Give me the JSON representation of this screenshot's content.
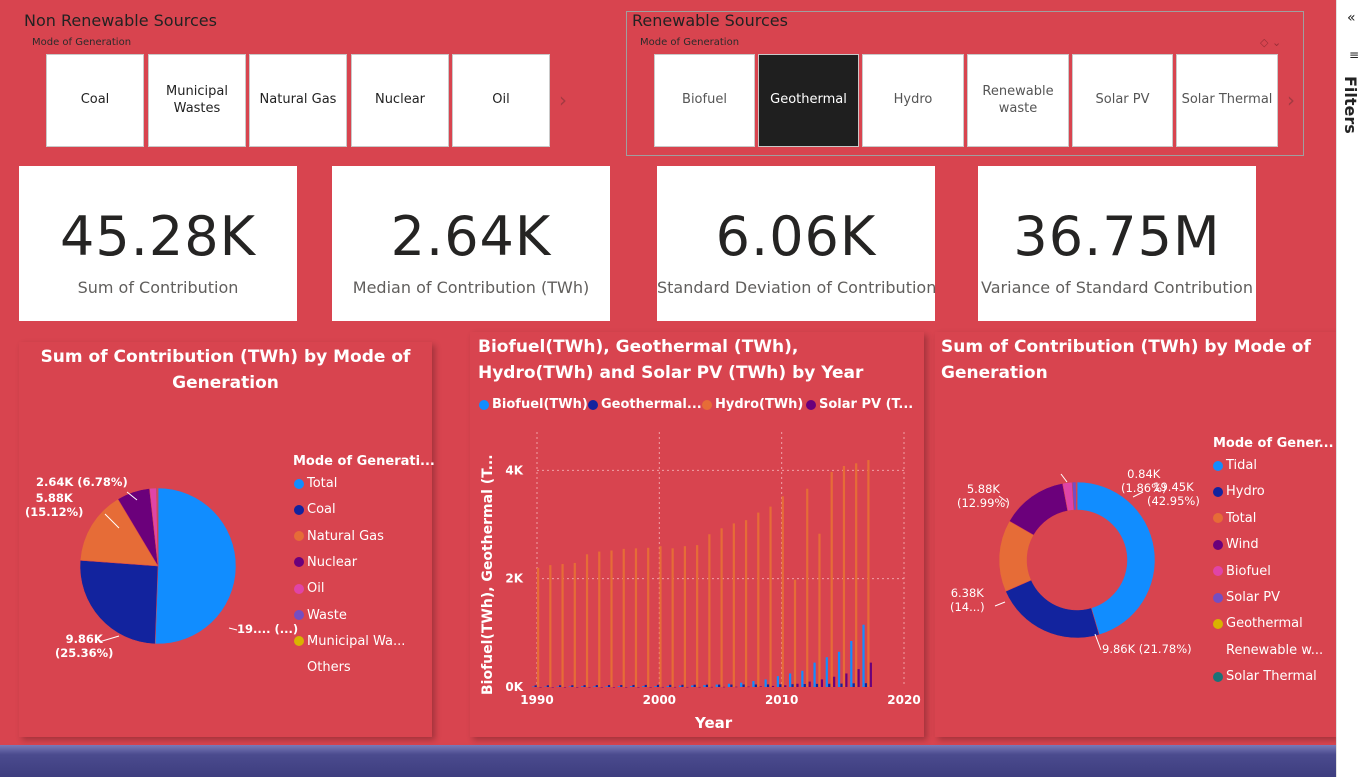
{
  "non_renewable": {
    "title": "Non Renewable Sources",
    "subtitle": "Mode of Generation",
    "options": [
      "Coal",
      "Municipal Wastes",
      "Natural Gas",
      "Nuclear",
      "Oil"
    ]
  },
  "renewable": {
    "title": "Renewable Sources",
    "subtitle": "Mode of Generation",
    "options": [
      "Biofuel",
      "Geothermal",
      "Hydro",
      "Renewable waste",
      "Solar PV",
      "Solar Thermal"
    ],
    "selected": "Geothermal"
  },
  "cards": [
    {
      "value": "45.28K",
      "label": "Sum of Contribution"
    },
    {
      "value": "2.64K",
      "label": "Median of Contribution (TWh)"
    },
    {
      "value": "6.06K",
      "label": "Standard Deviation of Contribution"
    },
    {
      "value": "36.75M",
      "label": "Variance of Standard Contribution"
    }
  ],
  "pie_panel": {
    "title": "Sum of Contribution (TWh) by Mode of Generation",
    "legend_title": "Mode of Generati...",
    "legend": [
      {
        "name": "Total",
        "color": "#118dff"
      },
      {
        "name": "Coal",
        "color": "#12239e"
      },
      {
        "name": "Natural Gas",
        "color": "#e66c37"
      },
      {
        "name": "Nuclear",
        "color": "#6b007b"
      },
      {
        "name": "Oil",
        "color": "#e044a7"
      },
      {
        "name": "Waste",
        "color": "#744ec2"
      },
      {
        "name": "Municipal Wa...",
        "color": "#d9b300"
      },
      {
        "name": "Others",
        "color": ""
      }
    ],
    "labels": {
      "total": "19.... (...)",
      "coal": "9.86K\n(25.36%)",
      "gas": "5.88K\n(15.12%)",
      "nuclear": "2.64K (6.78%)"
    }
  },
  "bar_panel": {
    "title": "Biofuel(TWh), Geothermal (TWh), Hydro(TWh) and Solar PV (TWh) by Year",
    "legend": [
      {
        "name": "Biofuel(TWh)",
        "color": "#118dff"
      },
      {
        "name": "Geothermal...",
        "color": "#12239e"
      },
      {
        "name": "Hydro(TWh)",
        "color": "#e66c37"
      },
      {
        "name": "Solar PV (T...",
        "color": "#6b007b"
      }
    ],
    "xlabel": "Year",
    "ylabel": "Biofuel(TWh), Geothermal (T..."
  },
  "donut_panel": {
    "title": "Sum of Contribution (TWh) by Mode of Generation",
    "legend_title": "Mode of Gener...",
    "legend": [
      {
        "name": "Tidal",
        "color": "#118dff"
      },
      {
        "name": "Hydro",
        "color": "#12239e"
      },
      {
        "name": "Total",
        "color": "#e66c37"
      },
      {
        "name": "Wind",
        "color": "#6b007b"
      },
      {
        "name": "Biofuel",
        "color": "#e044a7"
      },
      {
        "name": "Solar PV",
        "color": "#744ec2"
      },
      {
        "name": "Geothermal",
        "color": "#d9b300"
      },
      {
        "name": "Renewable w...",
        "color": ""
      },
      {
        "name": "Solar Thermal",
        "color": "#197278"
      }
    ],
    "labels": {
      "tidal": "19.45K\n(42.95%)",
      "hydro": "9.86K (21.78%)",
      "total": "6.38K\n(14...)",
      "wind": "5.88K\n(12.99%)",
      "biofuel": "0.84K\n(1.86%)"
    }
  },
  "filters_label": "Filters",
  "chart_data": [
    {
      "type": "pie",
      "title": "Sum of Contribution (TWh) by Mode of Generation",
      "categories": [
        "Total",
        "Coal",
        "Natural Gas",
        "Nuclear",
        "Oil",
        "Waste",
        "Municipal Wastes"
      ],
      "values": [
        19500,
        9860,
        5880,
        2640,
        550,
        80,
        40
      ]
    },
    {
      "type": "bar",
      "title": "Biofuel(TWh), Geothermal (TWh), Hydro(TWh) and Solar PV (TWh) by Year",
      "xlabel": "Year",
      "ylabel": "Biofuel(TWh), Geothermal (T...",
      "ylim": [
        0,
        4800
      ],
      "xlim": [
        1990,
        2020
      ],
      "xticks": [
        1990,
        2000,
        2010,
        2020
      ],
      "yticks": [
        0,
        2000,
        4000
      ],
      "ytick_labels": [
        "0K",
        "2K",
        "4K"
      ],
      "x": [
        1990,
        1991,
        1992,
        1993,
        1994,
        1995,
        1996,
        1997,
        1998,
        1999,
        2000,
        2001,
        2002,
        2003,
        2004,
        2005,
        2006,
        2007,
        2008,
        2009,
        2010,
        2011,
        2012,
        2013,
        2014,
        2015,
        2016,
        2017
      ],
      "series": [
        {
          "name": "Biofuel(TWh)",
          "values": [
            8,
            9,
            10,
            11,
            12,
            13,
            14,
            15,
            16,
            17,
            18,
            20,
            25,
            30,
            35,
            45,
            60,
            80,
            110,
            140,
            200,
            250,
            300,
            450,
            550,
            650,
            850,
            1150
          ]
        },
        {
          "name": "Geothermal...",
          "values": [
            30,
            31,
            32,
            33,
            34,
            35,
            36,
            37,
            38,
            39,
            40,
            40,
            41,
            42,
            43,
            44,
            45,
            46,
            47,
            48,
            50,
            52,
            55,
            58,
            60,
            63,
            68,
            70
          ]
        },
        {
          "name": "Hydro(TWh)",
          "values": [
            2200,
            2250,
            2270,
            2290,
            2450,
            2500,
            2520,
            2550,
            2560,
            2570,
            2600,
            2560,
            2600,
            2620,
            2820,
            2930,
            3020,
            3080,
            3220,
            3330,
            3520,
            1980,
            3660,
            2830,
            3970,
            4080,
            4130,
            4190
          ]
        },
        {
          "name": "Solar PV (T...",
          "values": [
            0,
            0,
            0,
            0,
            0,
            0,
            0,
            0,
            0,
            0,
            1,
            1,
            1,
            1,
            2,
            3,
            5,
            7,
            12,
            20,
            32,
            60,
            100,
            140,
            190,
            250,
            330,
            450
          ]
        }
      ]
    },
    {
      "type": "pie",
      "title": "Sum of Contribution (TWh) by Mode of Generation",
      "categories": [
        "Tidal",
        "Hydro",
        "Total",
        "Wind",
        "Biofuel",
        "Solar PV",
        "Geothermal",
        "Renewable waste",
        "Solar Thermal"
      ],
      "values": [
        19450,
        9860,
        6380,
        5880,
        840,
        350,
        40,
        30,
        10
      ]
    }
  ]
}
